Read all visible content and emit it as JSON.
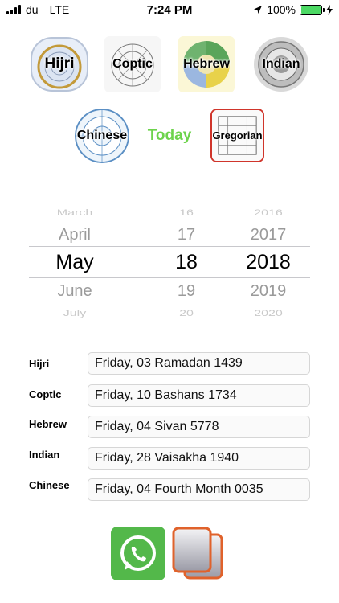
{
  "status_bar": {
    "carrier": "du",
    "network": "LTE",
    "time": "7:24 PM",
    "battery": "100%"
  },
  "calendars": {
    "hijri": "Hijri",
    "coptic": "Coptic",
    "hebrew": "Hebrew",
    "indian": "Indian",
    "chinese": "Chinese",
    "today": "Today",
    "gregorian": "Gregorian"
  },
  "picker": {
    "rows": [
      {
        "month": "March",
        "day": "16",
        "year": "2016"
      },
      {
        "month": "April",
        "day": "17",
        "year": "2017"
      },
      {
        "month": "May",
        "day": "18",
        "year": "2018"
      },
      {
        "month": "June",
        "day": "19",
        "year": "2019"
      },
      {
        "month": "July",
        "day": "20",
        "year": "2020"
      }
    ]
  },
  "conversions": [
    {
      "label": "Hijri",
      "value": "Friday, 03 Ramadan 1439"
    },
    {
      "label": "Coptic",
      "value": "Friday, 10 Bashans 1734"
    },
    {
      "label": "Hebrew",
      "value": "Friday, 04 Sivan 5778"
    },
    {
      "label": "Indian",
      "value": "Friday, 28 Vaisakha 1940"
    },
    {
      "label": "Chinese",
      "value": "Friday, 04 Fourth Month 0035"
    }
  ],
  "colors": {
    "accent_today": "#6dd34c",
    "gregorian_border": "#d0352b",
    "whatsapp": "#53b84a",
    "copy_border": "#e0622b"
  },
  "icons": {
    "whatsapp": "whatsapp-icon",
    "copy": "copy-icon"
  }
}
